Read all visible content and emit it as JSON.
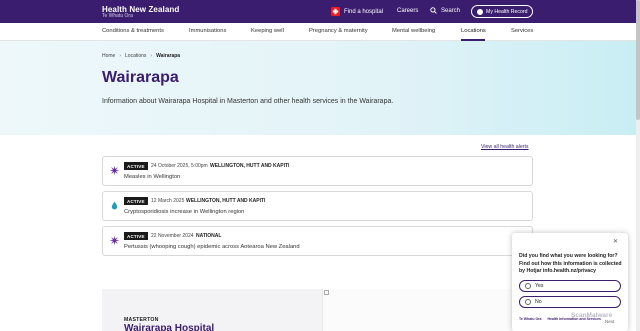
{
  "header": {
    "logo_title": "Health New Zealand",
    "logo_subtitle": "Te Whatu Ora",
    "find_hospital": "Find a hospital",
    "careers": "Careers",
    "search": "Search",
    "my_health_record": "My Health Record"
  },
  "nav": {
    "items": [
      "Conditions & treatments",
      "Immunisations",
      "Keeping well",
      "Pregnancy & maternity",
      "Mental wellbeing",
      "Locations",
      "Services"
    ],
    "active": "Locations"
  },
  "breadcrumb": [
    "Home",
    "Locations",
    "Wairarapa"
  ],
  "hero": {
    "title": "Wairarapa",
    "lead": "Information about Wairarapa Hospital in Masterton and other health services in the Wairarapa."
  },
  "alerts_link": "View all health alerts",
  "alerts": [
    {
      "badge": "ACTIVE",
      "date": "24 October 2025, 5:00pm",
      "region": "WELLINGTON, HUTT AND KAPITI",
      "title": "Measles in Wellington",
      "icon": "virus-icon"
    },
    {
      "badge": "ACTIVE",
      "date": "12 March 2025",
      "region": "WELLINGTON, HUTT AND KAPITI",
      "title": "Cryptosporidiosis increase in Wellington region",
      "icon": "water-drop-icon"
    },
    {
      "badge": "ACTIVE",
      "date": "22 November 2024",
      "region": "NATIONAL",
      "title": "Pertussis (whooping cough) epidemic across Aotearoa New Zealand",
      "icon": "virus-icon"
    }
  ],
  "hospital_card": {
    "label": "MASTERTON",
    "title": "Wairarapa Hospital"
  },
  "survey": {
    "question": "Did you find what you were looking for? Find out how this information is collected by Hotjar info.health.nz/privacy",
    "options": [
      "Yes",
      "No"
    ],
    "footer_logo_left": "Te Whatu Ora",
    "footer_logo_right": "Health Information and Services",
    "next": "Next"
  },
  "watermark": "ScanMalware",
  "colors": {
    "brand_purple": "#3a1d6e",
    "alert_badge": "#1a1a1a",
    "hero_teal": "#c8eef4",
    "cross_red": "#ed1c24",
    "virus_purple": "#6b2fa0",
    "drop_teal": "#1c9fb8"
  }
}
